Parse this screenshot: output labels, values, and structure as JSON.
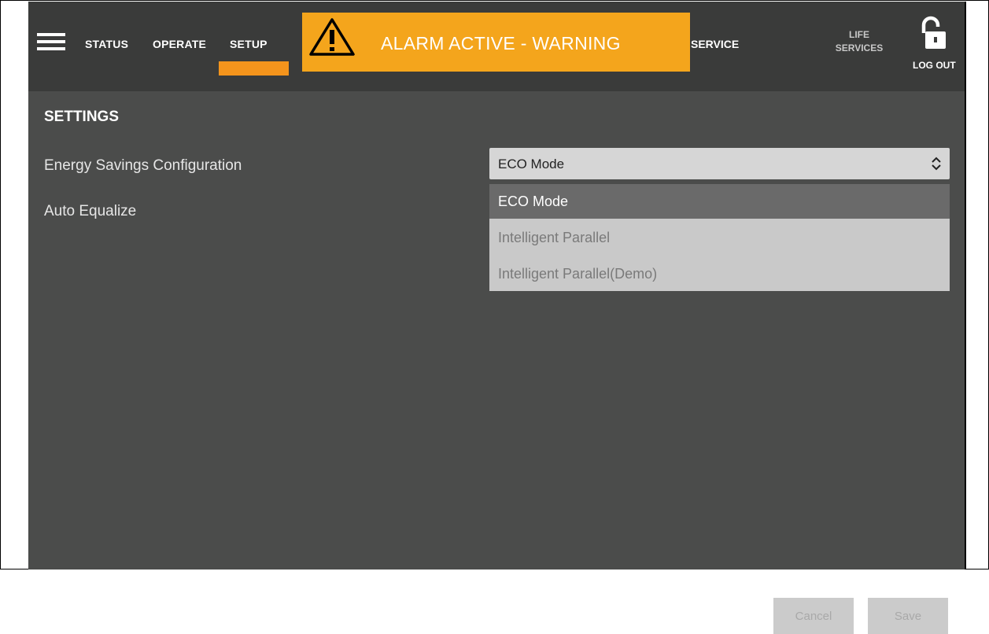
{
  "nav": {
    "menu_icon": "hamburger-icon",
    "tabs": [
      {
        "label": "STATUS"
      },
      {
        "label": "OPERATE"
      },
      {
        "label": "SETUP",
        "active": true
      },
      {
        "label": "SERVICE"
      }
    ],
    "alarm": {
      "text": "ALARM ACTIVE - WARNING",
      "icon": "warning-icon",
      "color": "#f4a51c"
    },
    "life_services": {
      "line1": "LIFE",
      "line2": "SERVICES"
    },
    "logout": {
      "label": "LOG OUT",
      "icon": "unlocked-padlock-icon"
    },
    "accent_color": "#f4941c"
  },
  "settings": {
    "title": "SETTINGS",
    "rows": [
      {
        "label": "Energy Savings Configuration"
      },
      {
        "label": "Auto Equalize"
      }
    ],
    "energy_select": {
      "value": "ECO Mode",
      "options": [
        "ECO Mode",
        "Intelligent Parallel",
        "Intelligent Parallel(Demo)"
      ],
      "highlighted": "ECO Mode"
    }
  },
  "actions": {
    "cancel_label": "Cancel",
    "save_label": "Save"
  }
}
